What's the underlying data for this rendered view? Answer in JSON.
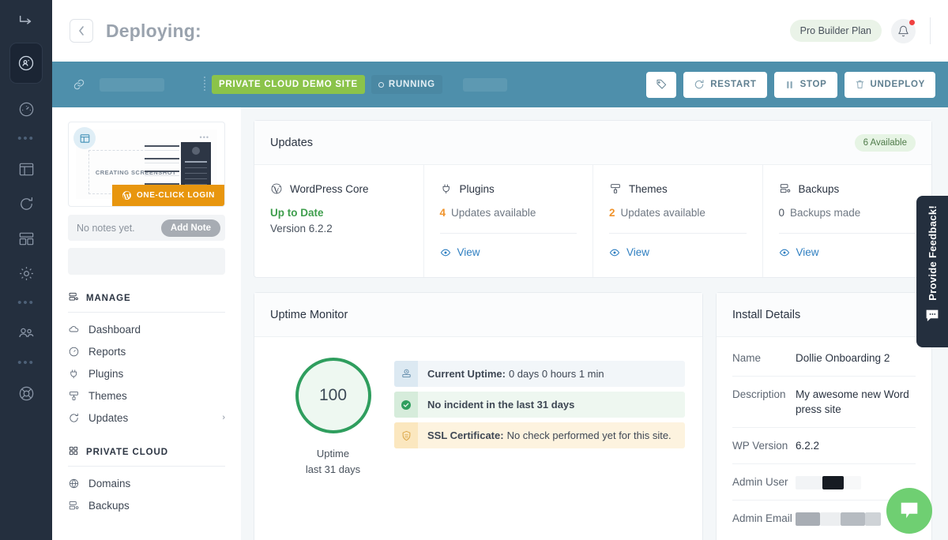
{
  "rail": {
    "logo_icon": "sidebar-toggle-icon",
    "items": [
      {
        "name": "sites-active-icon",
        "icon": "user-refresh-icon",
        "active": true
      },
      {
        "name": "dashboard-gauge-icon",
        "icon": "gauge-icon"
      },
      {
        "name": "divider-dots-1",
        "icon": "dots-icon"
      },
      {
        "name": "layout-icon",
        "icon": "window-layout-icon"
      },
      {
        "name": "sync-icon",
        "icon": "refresh-circle-icon"
      },
      {
        "name": "panels-icon",
        "icon": "dashboard-panels-icon"
      },
      {
        "name": "settings-icon",
        "icon": "gear-icon"
      },
      {
        "name": "divider-dots-2",
        "icon": "dots-icon"
      },
      {
        "name": "team-icon",
        "icon": "people-icon"
      },
      {
        "name": "divider-dots-3",
        "icon": "dots-icon"
      },
      {
        "name": "lifebuoy-icon",
        "icon": "support-icon"
      }
    ]
  },
  "header": {
    "back_label": "‹",
    "title": "Deploying:",
    "plan_badge": "Pro Builder Plan",
    "bell_icon": "bell-icon",
    "has_notification": true
  },
  "sitebar": {
    "link_icon": "link-icon",
    "site_chip": "PRIVATE CLOUD DEMO SITE",
    "status_chip": "RUNNING",
    "actions": [
      {
        "key": "tag",
        "label": "",
        "icon": "tag-icon"
      },
      {
        "key": "restart",
        "label": "RESTART",
        "icon": "restart-icon"
      },
      {
        "key": "stop",
        "label": "STOP",
        "icon": "pause-icon"
      },
      {
        "key": "undeploy",
        "label": "UNDEPLOY",
        "icon": "trash-icon"
      }
    ]
  },
  "sidebar": {
    "screenshot_placeholder": "CREATING SCREENSHOT",
    "one_click_login": "ONE-CLICK LOGIN",
    "notes_empty": "No notes yet.",
    "add_note": "Add Note",
    "groups": [
      {
        "title": "MANAGE",
        "icon": "server-list-icon",
        "items": [
          {
            "label": "Dashboard",
            "icon": "cloud-icon",
            "chevron": false
          },
          {
            "label": "Reports",
            "icon": "gauge-icon",
            "chevron": false
          },
          {
            "label": "Plugins",
            "icon": "plug-icon",
            "chevron": false
          },
          {
            "label": "Themes",
            "icon": "brush-icon",
            "chevron": false
          },
          {
            "label": "Updates",
            "icon": "refresh-icon",
            "chevron": true
          }
        ]
      },
      {
        "title": "PRIVATE CLOUD",
        "icon": "grid-icon",
        "items": [
          {
            "label": "Domains",
            "icon": "globe-icon",
            "chevron": false
          },
          {
            "label": "Backups",
            "icon": "server-list-icon",
            "chevron": false
          }
        ]
      }
    ]
  },
  "updates_card": {
    "title": "Updates",
    "badge": "6 Available",
    "columns": [
      {
        "label": "WordPress Core",
        "icon": "wordpress-icon",
        "status_text": "Up to Date",
        "status_style": "green",
        "sub_text": "Version 6.2.2",
        "has_view": false,
        "view_label": "View"
      },
      {
        "label": "Plugins",
        "icon": "plug-icon",
        "count": "4",
        "count_style": "orange",
        "count_text": "Updates available",
        "has_view": true,
        "view_label": "View"
      },
      {
        "label": "Themes",
        "icon": "brush-icon",
        "count": "2",
        "count_style": "orange",
        "count_text": "Updates available",
        "has_view": true,
        "view_label": "View"
      },
      {
        "label": "Backups",
        "icon": "server-list-icon",
        "count": "0",
        "count_style": "grey",
        "count_text": "Backups made",
        "has_view": true,
        "view_label": "View"
      }
    ]
  },
  "uptime_card": {
    "title": "Uptime Monitor",
    "gauge_value": "100",
    "gauge_caption_line1": "Uptime",
    "gauge_caption_line2": "last 31 days",
    "rows": [
      {
        "style": "blue",
        "icon": "server-clock-icon",
        "bold": "Current Uptime:",
        "text": "0 days 0 hours 1 min"
      },
      {
        "style": "green",
        "icon": "check-circle-icon",
        "bold": "No incident in the last 31 days",
        "text": ""
      },
      {
        "style": "amber",
        "icon": "shield-icon",
        "bold": "SSL Certificate:",
        "text": "No check performed yet for this site."
      }
    ]
  },
  "install_card": {
    "title": "Install Details",
    "rows": [
      {
        "key": "Name",
        "value": "Dollie Onboarding 2",
        "redacted": false
      },
      {
        "key": "Description",
        "value": "My awesome new Word press site",
        "redacted": false
      },
      {
        "key": "WP Version",
        "value": "6.2.2",
        "redacted": false
      },
      {
        "key": "Admin User",
        "value": "",
        "redacted": true,
        "redact_kind": "user"
      },
      {
        "key": "Admin Email",
        "value": "",
        "redacted": true,
        "redact_kind": "email"
      }
    ]
  },
  "feedback": {
    "label": "Provide Feedback!",
    "icon": "chat-bubble-icon"
  },
  "chat_widget": {
    "icon": "chat-bubble-icon"
  },
  "colors": {
    "rail_bg": "#242f3e",
    "teal_bar": "#4e8fab",
    "green_chip": "#8bc34a",
    "orange_accent": "#f0932b",
    "link_blue": "#2f7fc1",
    "uptime_green": "#2f9e5e",
    "one_click_orange": "#e8960e",
    "chat_green": "#6fcf72",
    "notification_red": "#f04141"
  }
}
